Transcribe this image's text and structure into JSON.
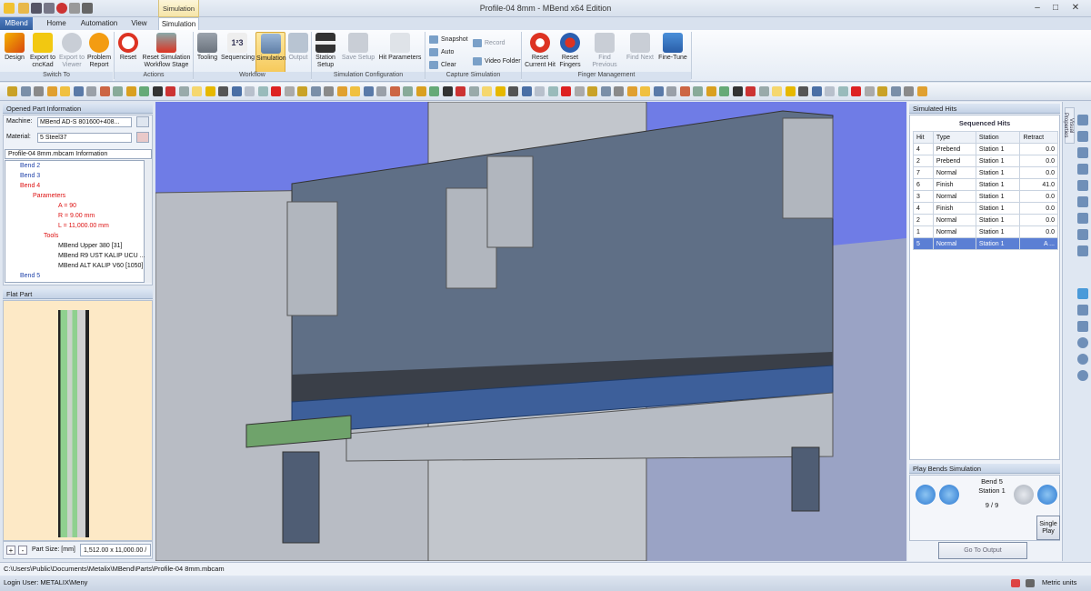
{
  "window": {
    "title": "Profile-04 8mm - MBend x64 Edition",
    "context_tab": "Simulation"
  },
  "tabs": [
    "MBend",
    "Home",
    "Automation",
    "View",
    "Simulation"
  ],
  "ribbon": {
    "groups": {
      "switch_to": "Switch To",
      "actions": "Actions",
      "workflow": "Workflow",
      "sim_config": "Simulation Configuration",
      "capture": "Capture Simulation",
      "finger": "Finger Management"
    },
    "buttons": {
      "design": "Design",
      "export_cnckad": "Export to cncKad",
      "export_viewer": "Export to Viewer",
      "problem_report": "Problem Report",
      "reset": "Reset",
      "reset_workflow": "Reset Simulation Workflow Stage",
      "tooling": "Tooling",
      "sequencing": "Sequencing",
      "simulation": "Simulation",
      "output": "Output",
      "station_setup": "Station Setup",
      "save_setup": "Save Setup",
      "hit_parameters": "Hit Parameters",
      "snapshot": "Snapshot",
      "auto": "Auto",
      "clear": "Clear",
      "record": "Record",
      "video_folder": "Video Folder",
      "reset_current_hit": "Reset Current Hit",
      "reset_fingers": "Reset Fingers",
      "find_previous": "Find Previous",
      "find_next": "Find Next",
      "fine_tune": "Fine-Tune"
    }
  },
  "left_panel": {
    "title": "Opened Part Information",
    "machine_label": "Machine:",
    "machine_value": "MBend AD-S 801600+408...",
    "material_label": "Material:",
    "material_value": "5 Steel37",
    "info_title": "Profile-04 8mm.mbcam Information",
    "tree": {
      "bend2": "Bend 2",
      "bend3": "Bend 3",
      "bend4": "Bend 4",
      "parameters": "Parameters",
      "angle": "A = 90",
      "radius": "R = 9.00 mm",
      "length": "L = 11,000.00 mm",
      "tools": "Tools",
      "tool1": "MBend Upper 380 [31]",
      "tool2": "MBend R9 UST KALIP UCU ...",
      "tool3": "MBend ALT KALIP V60 [1050]",
      "bend5": "Bend 5"
    }
  },
  "flat_part": {
    "title": "Flat Part",
    "part_size_label": "Part Size: [mm]",
    "part_size_value": "1,512.00 x 11,000.00 /",
    "plus": "+",
    "minus": "-"
  },
  "simulated_hits": {
    "title": "Simulated Hits",
    "table_title": "Sequenced Hits",
    "headers": [
      "Hit",
      "Type",
      "Station",
      "Retract"
    ],
    "rows": [
      [
        "4",
        "Prebend",
        "Station 1",
        "0.0"
      ],
      [
        "2",
        "Prebend",
        "Station 1",
        "0.0"
      ],
      [
        "7",
        "Normal",
        "Station 1",
        "0.0"
      ],
      [
        "6",
        "Finish",
        "Station 1",
        "41.0"
      ],
      [
        "3",
        "Normal",
        "Station 1",
        "0.0"
      ],
      [
        "4",
        "Finish",
        "Station 1",
        "0.0"
      ],
      [
        "2",
        "Normal",
        "Station 1",
        "0.0"
      ],
      [
        "1",
        "Normal",
        "Station 1",
        "0.0"
      ],
      [
        "5",
        "Normal",
        "Station 1",
        "A ..."
      ]
    ],
    "selected_row": 8
  },
  "play": {
    "title": "Play Bends Simulation",
    "bend": "Bend 5",
    "station": "Station 1",
    "progress": "9 / 9",
    "single_play": "Single Play",
    "go_to_output": "Go To Output"
  },
  "sidebar_label": "Visual Properties",
  "path": "C:\\Users\\Public\\Documents\\Metalix\\MBend\\Parts\\Profile-04 8mm.mbcam",
  "status": {
    "login": "Login User: METALIX\\Meny",
    "units": "Metric units"
  },
  "colors": {
    "viewport_bg": "#6f7ce6",
    "selection": "#5b7fd4",
    "accent": "#2b63c6"
  }
}
